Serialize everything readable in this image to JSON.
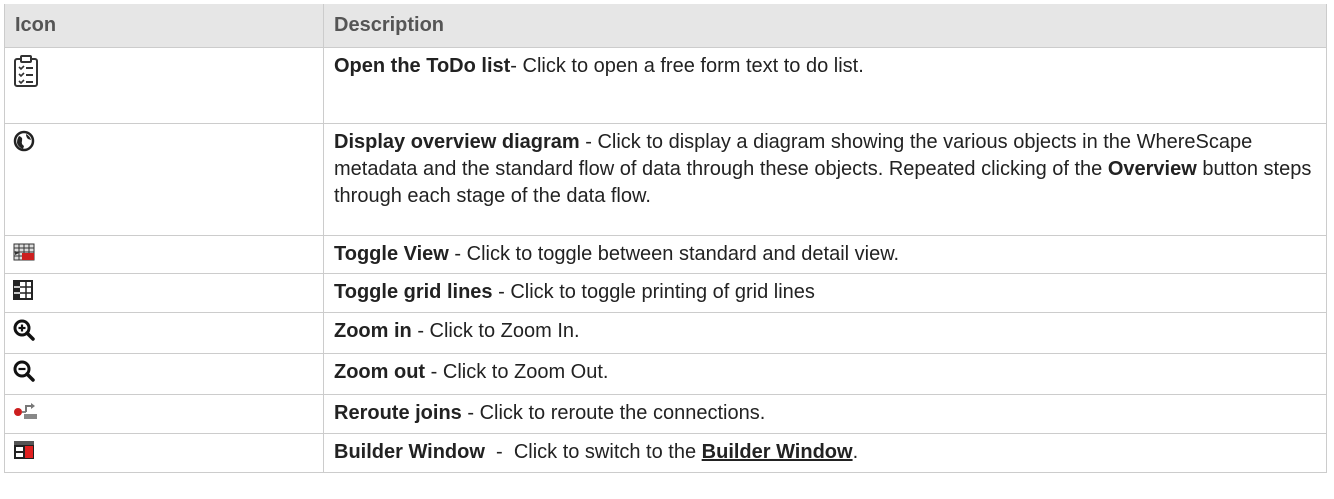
{
  "table": {
    "headers": {
      "icon": "Icon",
      "description": "Description"
    },
    "rows": [
      {
        "icon": "clipboard-list-icon",
        "title": "Open the ToDo list",
        "sep": "- ",
        "text": "Click to open a free form text to do list."
      },
      {
        "icon": "globe-icon",
        "title": "Display overview diagram",
        "sep": " - ",
        "text": "Click to display a diagram showing the various objects in the WhereScape metadata and the standard flow of data through these objects. Repeated clicking of the ",
        "bold2": "Overview",
        "text2": " button steps through each stage of the data flow."
      },
      {
        "icon": "toggle-view-icon",
        "title": "Toggle View",
        "sep": " - ",
        "text": "Click to toggle between standard and detail view."
      },
      {
        "icon": "grid-lines-icon",
        "title": "Toggle grid lines",
        "sep": " - ",
        "text": "Click to toggle printing of grid lines"
      },
      {
        "icon": "zoom-in-icon",
        "title": "Zoom in",
        "sep": " - ",
        "text": "Click to Zoom In."
      },
      {
        "icon": "zoom-out-icon",
        "title": "Zoom out",
        "sep": " - ",
        "text": "Click to Zoom Out."
      },
      {
        "icon": "reroute-joins-icon",
        "title": "Reroute joins",
        "sep": " - ",
        "text": "Click to reroute the connections."
      },
      {
        "icon": "builder-window-icon",
        "title": "Builder Window",
        "sep": "  -  ",
        "text": "Click to switch to the ",
        "link": "Builder Window",
        "text2": "."
      }
    ]
  },
  "colors": {
    "header_bg": "#e6e6e6",
    "border": "#cccccc",
    "icon_red": "#cc1f1f",
    "icon_dark": "#333333"
  }
}
